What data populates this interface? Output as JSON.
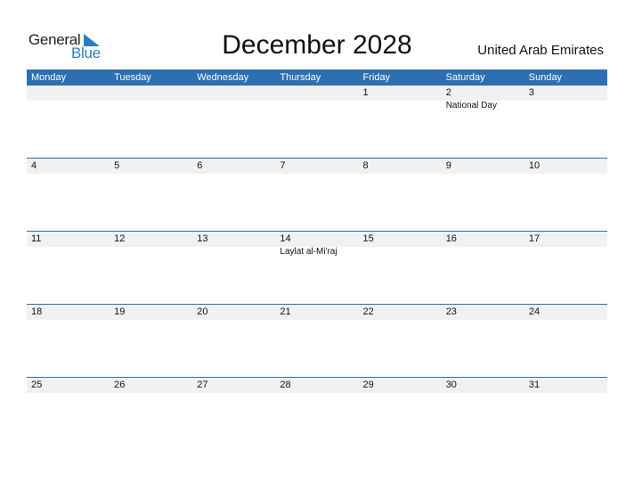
{
  "logo": {
    "line1": "General",
    "line2": "Blue",
    "accent": "#2a7fc1"
  },
  "title": "December 2028",
  "country": "United Arab Emirates",
  "colors": {
    "header_bg": "#2d6fb0",
    "row_band": "#f1f1f1"
  },
  "weekdays": [
    "Monday",
    "Tuesday",
    "Wednesday",
    "Thursday",
    "Friday",
    "Saturday",
    "Sunday"
  ],
  "weeks": [
    [
      {
        "day": "",
        "event": ""
      },
      {
        "day": "",
        "event": ""
      },
      {
        "day": "",
        "event": ""
      },
      {
        "day": "",
        "event": ""
      },
      {
        "day": "1",
        "event": ""
      },
      {
        "day": "2",
        "event": "National Day"
      },
      {
        "day": "3",
        "event": ""
      }
    ],
    [
      {
        "day": "4",
        "event": ""
      },
      {
        "day": "5",
        "event": ""
      },
      {
        "day": "6",
        "event": ""
      },
      {
        "day": "7",
        "event": ""
      },
      {
        "day": "8",
        "event": ""
      },
      {
        "day": "9",
        "event": ""
      },
      {
        "day": "10",
        "event": ""
      }
    ],
    [
      {
        "day": "11",
        "event": ""
      },
      {
        "day": "12",
        "event": ""
      },
      {
        "day": "13",
        "event": ""
      },
      {
        "day": "14",
        "event": "Laylat al-Mi'raj"
      },
      {
        "day": "15",
        "event": ""
      },
      {
        "day": "16",
        "event": ""
      },
      {
        "day": "17",
        "event": ""
      }
    ],
    [
      {
        "day": "18",
        "event": ""
      },
      {
        "day": "19",
        "event": ""
      },
      {
        "day": "20",
        "event": ""
      },
      {
        "day": "21",
        "event": ""
      },
      {
        "day": "22",
        "event": ""
      },
      {
        "day": "23",
        "event": ""
      },
      {
        "day": "24",
        "event": ""
      }
    ],
    [
      {
        "day": "25",
        "event": ""
      },
      {
        "day": "26",
        "event": ""
      },
      {
        "day": "27",
        "event": ""
      },
      {
        "day": "28",
        "event": ""
      },
      {
        "day": "29",
        "event": ""
      },
      {
        "day": "30",
        "event": ""
      },
      {
        "day": "31",
        "event": ""
      }
    ]
  ]
}
